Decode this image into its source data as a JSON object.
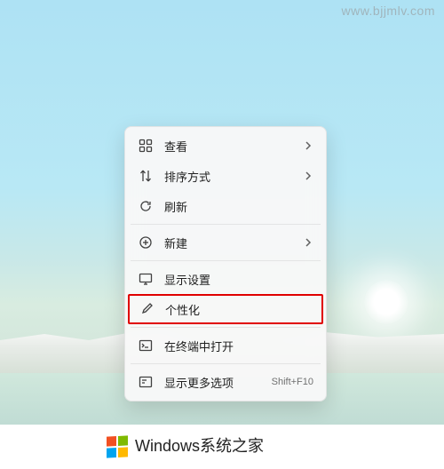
{
  "watermark": {
    "url": "www.bjjmlv.com"
  },
  "menu": {
    "view": {
      "label": "查看"
    },
    "sort": {
      "label": "排序方式"
    },
    "refresh": {
      "label": "刷新"
    },
    "new": {
      "label": "新建"
    },
    "display": {
      "label": "显示设置"
    },
    "personalize": {
      "label": "个性化"
    },
    "terminal": {
      "label": "在终端中打开"
    },
    "more": {
      "label": "显示更多选项",
      "shortcut": "Shift+F10"
    }
  },
  "attribution": {
    "brand": "Windows",
    "suffix": "系统之家"
  }
}
